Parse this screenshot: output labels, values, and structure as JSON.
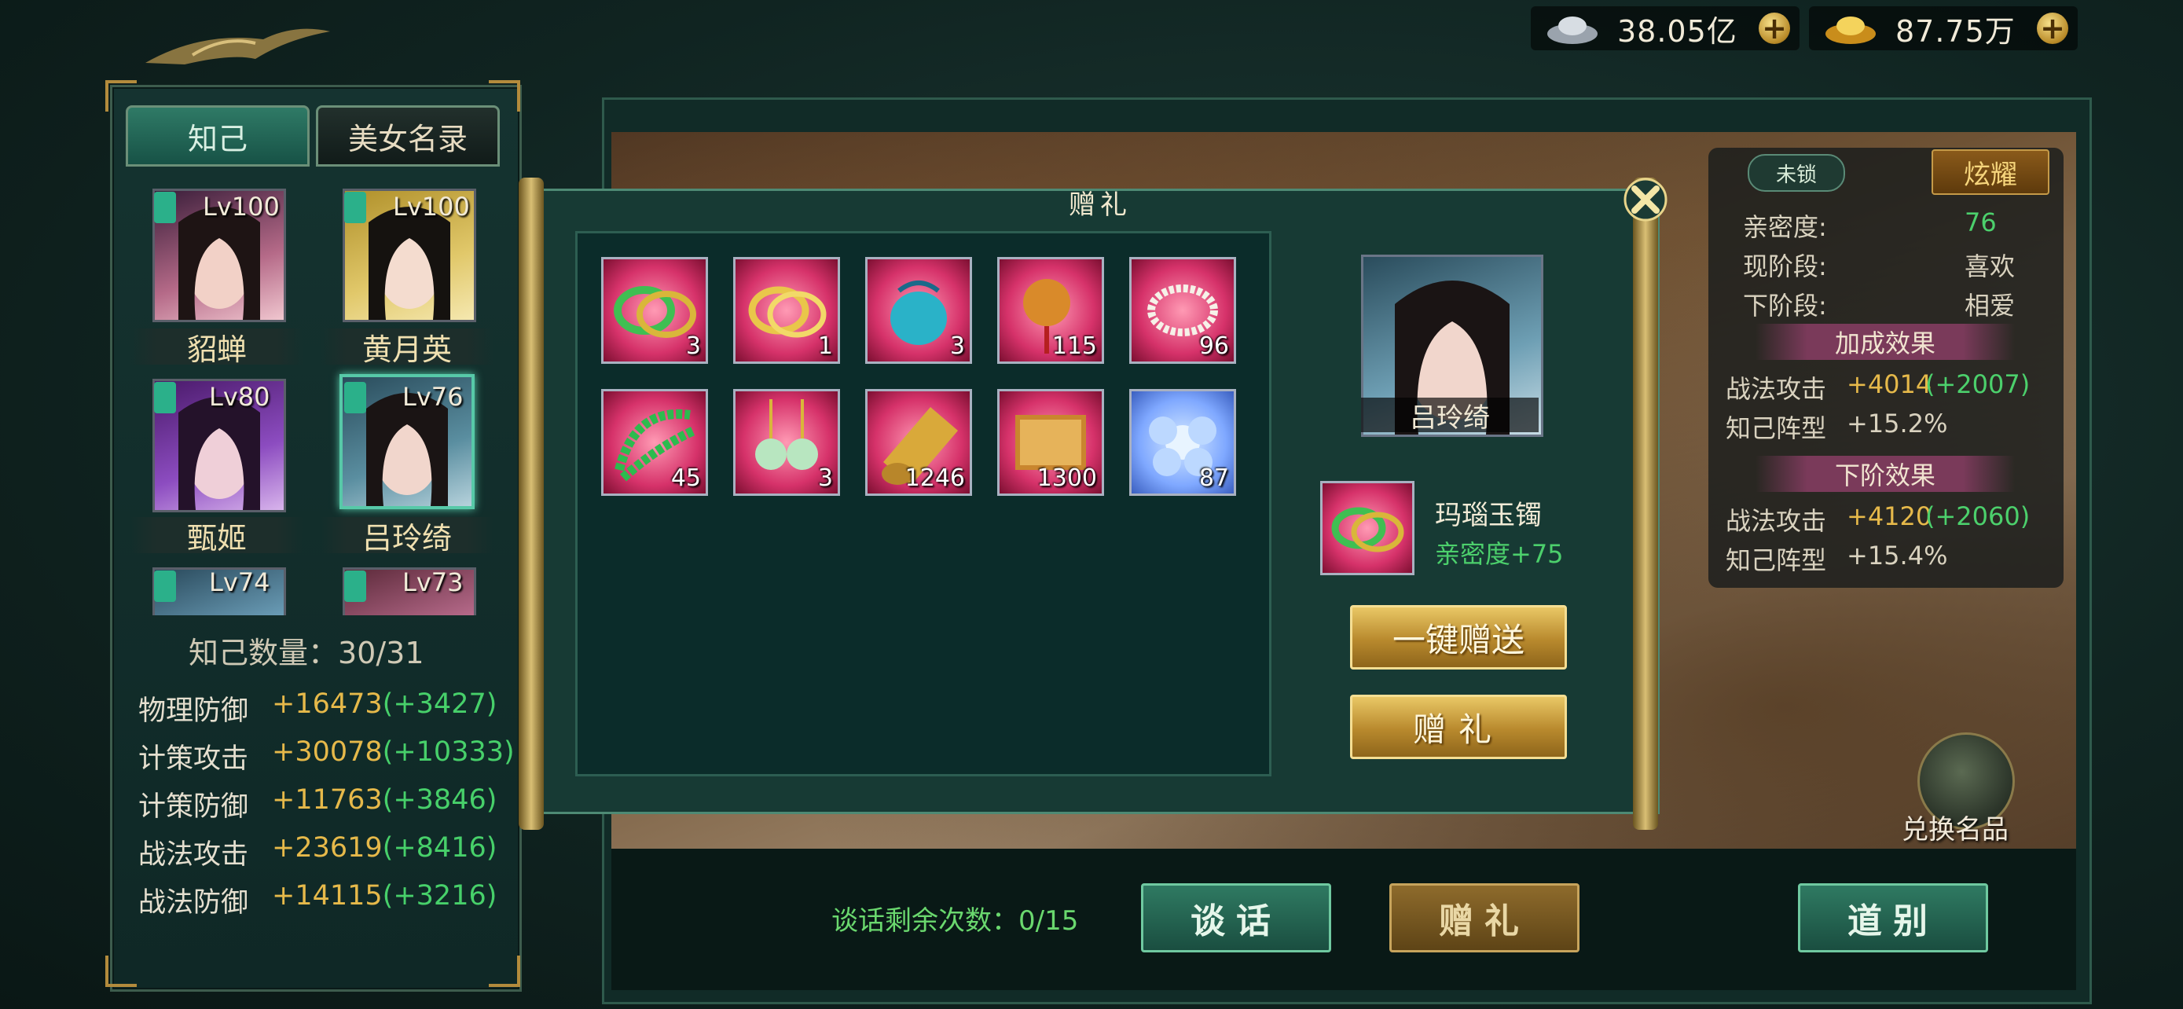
{
  "currency": {
    "silver": {
      "icon": "silver-ingot-icon",
      "value": "38.05亿"
    },
    "gold": {
      "icon": "gold-ingot-icon",
      "value": "87.75万"
    }
  },
  "left": {
    "tabs": [
      "知己",
      "美女名录"
    ],
    "confidants": [
      {
        "level": "Lv100",
        "name": "貂蝉"
      },
      {
        "level": "Lv100",
        "name": "黄月英"
      },
      {
        "level": "Lv80",
        "name": "甄姬"
      },
      {
        "level": "Lv76",
        "name": "吕玲绮"
      },
      {
        "level": "Lv74",
        "name": ""
      },
      {
        "level": "Lv73",
        "name": ""
      }
    ],
    "count_label": "知己数量：30/31",
    "stats": [
      {
        "label": "物理防御",
        "value": "+16473",
        "bonus": "(+3427)"
      },
      {
        "label": "计策攻击",
        "value": "+30078",
        "bonus": "(+10333)"
      },
      {
        "label": "计策防御",
        "value": "+11763",
        "bonus": "(+3846)"
      },
      {
        "label": "战法攻击",
        "value": "+23619",
        "bonus": "(+8416)"
      },
      {
        "label": "战法防御",
        "value": "+14115",
        "bonus": "(+3216)"
      }
    ]
  },
  "info": {
    "lock_label": "未锁",
    "flaunt_label": "炫耀",
    "intimacy_label": "亲密度:",
    "intimacy_value": "76",
    "stage_label": "现阶段:",
    "stage_value": "喜欢",
    "next_stage_label": "下阶段:",
    "next_stage_value": "相爱",
    "bonus_title": "加成效果",
    "bonus": [
      {
        "label": "战法攻击",
        "value": "+4014",
        "extra": "(+2007)"
      },
      {
        "label": "知己阵型",
        "value": "+15.2%",
        "extra": ""
      }
    ],
    "next_title": "下阶效果",
    "next": [
      {
        "label": "战法攻击",
        "value": "+4120",
        "extra": "(+2060)"
      },
      {
        "label": "知己阵型",
        "value": "+15.4%",
        "extra": ""
      }
    ],
    "exchange_label": "兑换名品"
  },
  "dialog": {
    "title": "赠礼",
    "items": [
      {
        "kind": "jade-bracelet",
        "qty": "3"
      },
      {
        "kind": "gold-bracelet",
        "qty": "1"
      },
      {
        "kind": "blue-pouch",
        "qty": "3"
      },
      {
        "kind": "bead-ornament",
        "qty": "115"
      },
      {
        "kind": "pearl-necklace",
        "qty": "96"
      },
      {
        "kind": "jade-beads",
        "qty": "45"
      },
      {
        "kind": "jade-earrings",
        "qty": "3"
      },
      {
        "kind": "silk-roll",
        "qty": "1246"
      },
      {
        "kind": "book-scroll",
        "qty": "1300"
      },
      {
        "kind": "crystal-flower",
        "qty": "87"
      }
    ],
    "target_name": "吕玲绮",
    "selected_item_name": "玛瑙玉镯",
    "selected_item_effect": "亲密度+75",
    "one_key_label": "一键赠送",
    "gift_label": "赠礼"
  },
  "bottom": {
    "talk_remaining": "谈话剩余次数：0/15",
    "talk_label": "谈话",
    "gift_label": "赠礼",
    "farewell_label": "道别"
  }
}
